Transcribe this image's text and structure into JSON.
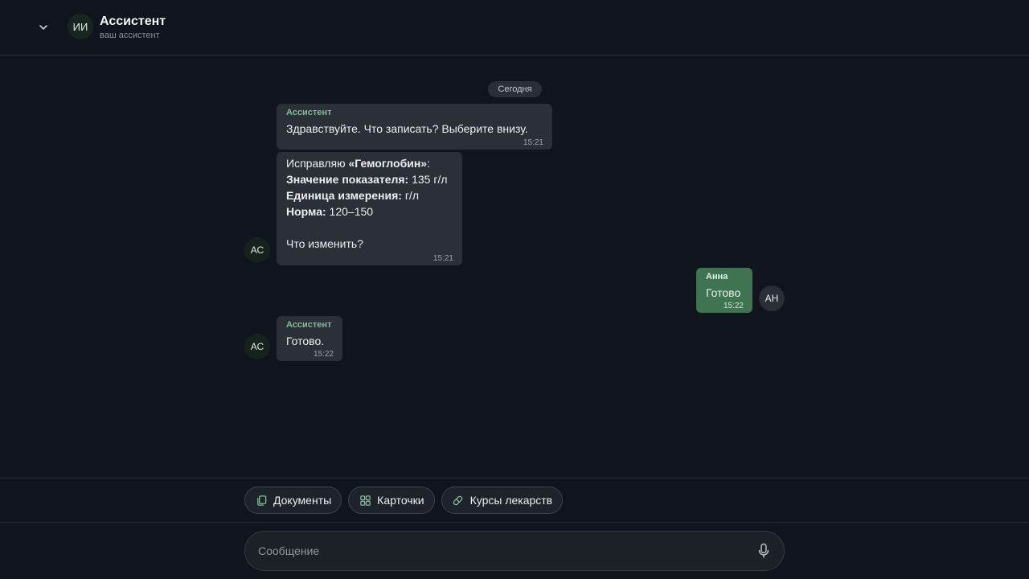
{
  "header": {
    "avatar_initials": "ИИ",
    "title": "Ассистент",
    "subtitle": "ваш ассистент"
  },
  "chat": {
    "date_label": "Сегодня",
    "messages": [
      {
        "sender": "Ассистент",
        "text": "Здравствуйте. Что записать? Выберите внизу.",
        "time": "15:21"
      },
      {
        "avatar": "АС",
        "intro_prefix": "Исправляю ",
        "intro_bold": "«Гемоглобин»",
        "intro_suffix": ":",
        "fields": [
          {
            "label": "Значение показателя:",
            "value": " 135 г/л"
          },
          {
            "label": "Единица измерения:",
            "value": " г/л"
          },
          {
            "label": "Норма:",
            "value": " 120–150"
          }
        ],
        "question": "Что изменить?",
        "time": "15:21"
      },
      {
        "avatar": "АН",
        "sender": "Анна",
        "text": "Готово",
        "time": "15:22"
      },
      {
        "avatar": "АС",
        "sender": "Ассистент",
        "text": "Готово.",
        "time": "15:22"
      }
    ]
  },
  "quick_actions": [
    {
      "label": "Документы",
      "icon": "documents-icon"
    },
    {
      "label": "Карточки",
      "icon": "grid-icon"
    },
    {
      "label": "Курсы лекарств",
      "icon": "pill-icon"
    }
  ],
  "composer": {
    "placeholder": "Сообщение",
    "value": ""
  },
  "colors": {
    "background": "#10141c",
    "incoming_bubble": "#2b2f38",
    "outgoing_bubble": "#3f7451",
    "accent": "#7fbf96"
  }
}
